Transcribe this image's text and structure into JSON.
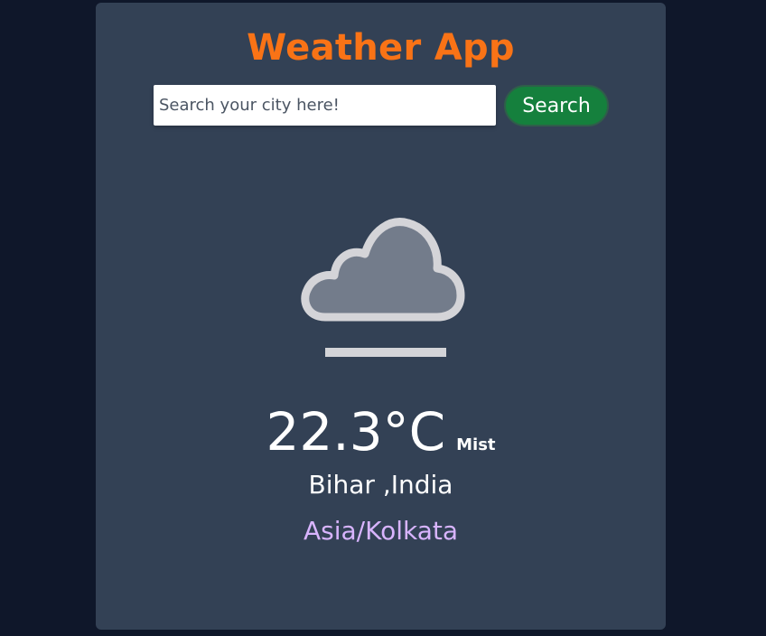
{
  "app": {
    "title": "Weather App"
  },
  "search": {
    "placeholder": "Search your city here!",
    "value": "",
    "button_label": "Search"
  },
  "weather": {
    "icon": "mist-cloud-icon",
    "temperature": "22.3°C",
    "condition": "Mist",
    "location": "Bihar ,India",
    "timezone": "Asia/Kolkata"
  },
  "colors": {
    "page_background": "#0f172a",
    "card_background": "#334155",
    "title": "#f97316",
    "search_button": "#15803d",
    "timezone_text": "#d8b4fe",
    "icon_outline": "#d4d4d8",
    "icon_fill": "#737c8b"
  }
}
